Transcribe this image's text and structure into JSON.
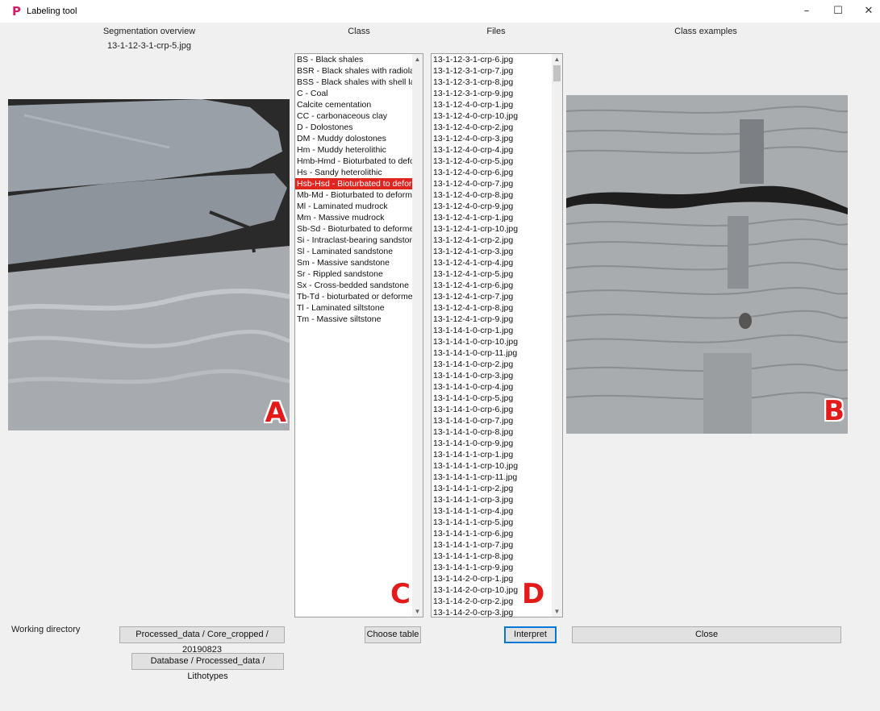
{
  "window": {
    "title": "Labeling tool",
    "minimize": "–",
    "maximize": "☐",
    "close": "✕"
  },
  "headers": {
    "segmentation_overview": "Segmentation overview",
    "current_file": "13-1-12-3-1-crp-5.jpg",
    "class": "Class",
    "files": "Files",
    "class_examples": "Class examples"
  },
  "panel_letters": {
    "a": "A",
    "b": "B",
    "c": "C",
    "d": "D"
  },
  "class_list": {
    "selected_index": 11,
    "items": [
      "BS - Black shales",
      "BSR - Black shales with radiolarians",
      "BSS - Black shales with shell lamina",
      "C - Coal",
      "Calcite cementation",
      "CC - carbonaceous clay",
      "D - Dolostones",
      "DM - Muddy dolostones",
      "Hm - Muddy heterolithic",
      "Hmb-Hmd - Bioturbated to deformed",
      "Hs - Sandy heterolithic",
      "Hsb-Hsd - Bioturbated to deformed",
      "Mb-Md - Bioturbated to deformed",
      "Ml - Laminated mudrock",
      "Mm - Massive mudrock",
      "Sb-Sd - Bioturbated to deformed",
      "Si - Intraclast-bearing sandstone",
      "Sl - Laminated sandstone",
      "Sm - Massive sandstone",
      "Sr - Rippled sandstone",
      "Sx - Cross-bedded sandstone",
      "Tb-Td - bioturbated or deformed",
      "Tl - Laminated siltstone",
      "Tm - Massive siltstone"
    ]
  },
  "file_list": {
    "items": [
      "13-1-12-3-1-crp-6.jpg",
      "13-1-12-3-1-crp-7.jpg",
      "13-1-12-3-1-crp-8.jpg",
      "13-1-12-3-1-crp-9.jpg",
      "13-1-12-4-0-crp-1.jpg",
      "13-1-12-4-0-crp-10.jpg",
      "13-1-12-4-0-crp-2.jpg",
      "13-1-12-4-0-crp-3.jpg",
      "13-1-12-4-0-crp-4.jpg",
      "13-1-12-4-0-crp-5.jpg",
      "13-1-12-4-0-crp-6.jpg",
      "13-1-12-4-0-crp-7.jpg",
      "13-1-12-4-0-crp-8.jpg",
      "13-1-12-4-0-crp-9.jpg",
      "13-1-12-4-1-crp-1.jpg",
      "13-1-12-4-1-crp-10.jpg",
      "13-1-12-4-1-crp-2.jpg",
      "13-1-12-4-1-crp-3.jpg",
      "13-1-12-4-1-crp-4.jpg",
      "13-1-12-4-1-crp-5.jpg",
      "13-1-12-4-1-crp-6.jpg",
      "13-1-12-4-1-crp-7.jpg",
      "13-1-12-4-1-crp-8.jpg",
      "13-1-12-4-1-crp-9.jpg",
      "13-1-14-1-0-crp-1.jpg",
      "13-1-14-1-0-crp-10.jpg",
      "13-1-14-1-0-crp-11.jpg",
      "13-1-14-1-0-crp-2.jpg",
      "13-1-14-1-0-crp-3.jpg",
      "13-1-14-1-0-crp-4.jpg",
      "13-1-14-1-0-crp-5.jpg",
      "13-1-14-1-0-crp-6.jpg",
      "13-1-14-1-0-crp-7.jpg",
      "13-1-14-1-0-crp-8.jpg",
      "13-1-14-1-0-crp-9.jpg",
      "13-1-14-1-1-crp-1.jpg",
      "13-1-14-1-1-crp-10.jpg",
      "13-1-14-1-1-crp-11.jpg",
      "13-1-14-1-1-crp-2.jpg",
      "13-1-14-1-1-crp-3.jpg",
      "13-1-14-1-1-crp-4.jpg",
      "13-1-14-1-1-crp-5.jpg",
      "13-1-14-1-1-crp-6.jpg",
      "13-1-14-1-1-crp-7.jpg",
      "13-1-14-1-1-crp-8.jpg",
      "13-1-14-1-1-crp-9.jpg",
      "13-1-14-2-0-crp-1.jpg",
      "13-1-14-2-0-crp-10.jpg",
      "13-1-14-2-0-crp-2.jpg",
      "13-1-14-2-0-crp-3.jpg"
    ]
  },
  "bottom": {
    "working_directory_label": "Working directory",
    "processed_path_button": "Processed_data / Core_cropped / 20190823",
    "database_path_button": "Database / Processed_data / Lithotypes",
    "choose_table_button": "Choose table",
    "interpret_button": "Interpret",
    "close_button": "Close"
  },
  "icons": {
    "app": "app-logo-icon",
    "scroll_up": "chevron-up-icon",
    "scroll_down": "chevron-down-icon"
  },
  "colors": {
    "selection": "#e0241f",
    "panel_letter": "#e31a1a",
    "background": "#f0f0f0"
  }
}
